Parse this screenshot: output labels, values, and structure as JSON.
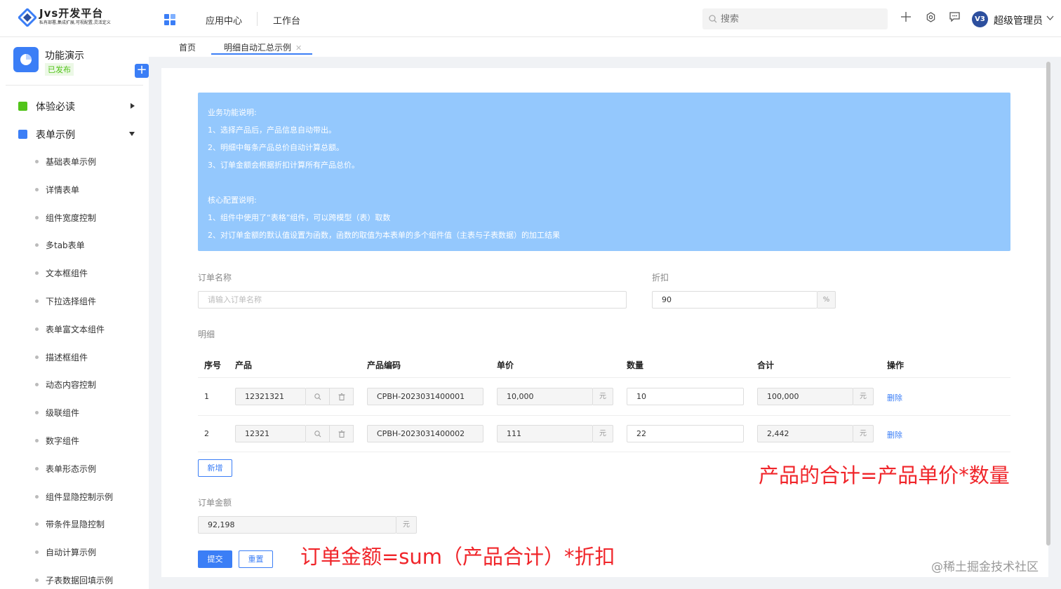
{
  "header": {
    "logo_title": "Jvs开发平台",
    "logo_subtitle": "私有部署,集成扩展,可视配置,灵活定义",
    "nav": [
      "应用中心",
      "工作台"
    ],
    "search_placeholder": "搜索",
    "avatar_text": "V3",
    "username": "超级管理员"
  },
  "sidebar": {
    "app_name": "功能演示",
    "app_status": "已发布",
    "groups": [
      {
        "label": "体验必读",
        "icon_color": "#52c41a"
      },
      {
        "label": "表单示例",
        "icon_color": "#3b7ef6"
      }
    ],
    "items": [
      "基础表单示例",
      "详情表单",
      "组件宽度控制",
      "多tab表单",
      "文本框组件",
      "下拉选择组件",
      "表单富文本组件",
      "描述框组件",
      "动态内容控制",
      "级联组件",
      "数字组件",
      "表单形态示例",
      "组件显隐控制示例",
      "带条件显隐控制",
      "自动计算示例",
      "子表数据回填示例"
    ]
  },
  "tabs": [
    {
      "label": "首页"
    },
    {
      "label": "明细自动汇总示例",
      "active": true
    }
  ],
  "info": {
    "lines": [
      "业务功能说明:",
      "1、选择产品后，产品信息自动带出。",
      "2、明细中每条产品总价自动计算总额。",
      "3、订单金额会根据折扣计算所有产品总价。",
      "",
      "核心配置说明:",
      "1、组件中使用了“表格”组件，可以跨模型（表）取数",
      "2、对订单金额的默认值设置为函数，函数的取值为本表单的多个组件值（主表与子表数据）的加工结果"
    ],
    "bg_color": "#94c8fd"
  },
  "form": {
    "order_name_label": "订单名称",
    "order_name_placeholder": "请输入订单名称",
    "discount_label": "折扣",
    "discount_value": "90",
    "discount_suffix": "%",
    "detail_label": "明细",
    "columns": [
      "序号",
      "产品",
      "产品编码",
      "单价",
      "数量",
      "合计",
      "操作"
    ],
    "rows": [
      {
        "index": "1",
        "product": "12321321",
        "code": "CPBH-2023031400001",
        "price": "10,000",
        "qty": "10",
        "total": "100,000",
        "action": "删除"
      },
      {
        "index": "2",
        "product": "12321",
        "code": "CPBH-2023031400002",
        "price": "111",
        "qty": "22",
        "total": "2,442",
        "action": "删除"
      }
    ],
    "currency_suffix": "元",
    "add_button": "新增",
    "amount_label": "订单金额",
    "amount_value": "92,198",
    "submit_button": "提交",
    "reset_button": "重置"
  },
  "annotations": {
    "product_total": "产品的合计=产品单价*数量",
    "order_amount": "订单金额=sum（产品合计）*折扣"
  },
  "watermark": "@稀土掘金技术社区"
}
